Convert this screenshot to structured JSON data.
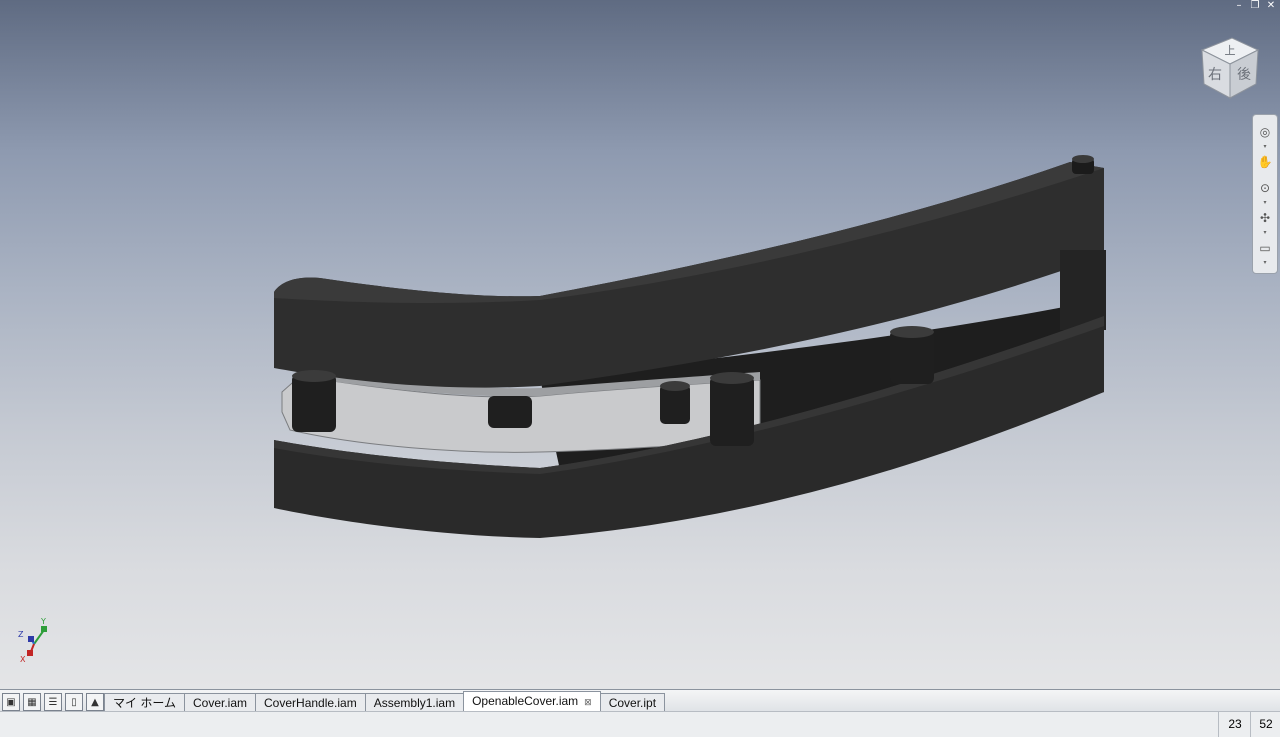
{
  "window": {
    "minimize_icon": "minimize-icon",
    "restore_icon": "restore-icon",
    "close_icon": "close-icon",
    "minimize_glyph": "–",
    "restore_glyph": "❐",
    "close_glyph": "✕"
  },
  "viewcube": {
    "top_face": "上",
    "left_face": "右",
    "right_face": "後"
  },
  "navbar": {
    "items": [
      "steering-wheel-icon",
      "pan-icon",
      "zoom-icon",
      "orbit-icon",
      "look-at-icon"
    ]
  },
  "triad": {
    "x": "X",
    "y": "Y",
    "z": "Z"
  },
  "tab_bar": {
    "tabs": [
      {
        "label": "マイ ホーム",
        "active": false
      },
      {
        "label": "Cover.iam",
        "active": false
      },
      {
        "label": "CoverHandle.iam",
        "active": false
      },
      {
        "label": "Assembly1.iam",
        "active": false
      },
      {
        "label": "OpenableCover.iam",
        "active": true,
        "close": "⊠"
      },
      {
        "label": "Cover.ipt",
        "active": false
      }
    ]
  },
  "status_bar": {
    "value_1": "23",
    "value_2": "52"
  },
  "colors": {
    "part": "#2b2b2b",
    "plate": "#c8c9cb",
    "accent": "#2e6fd6"
  }
}
